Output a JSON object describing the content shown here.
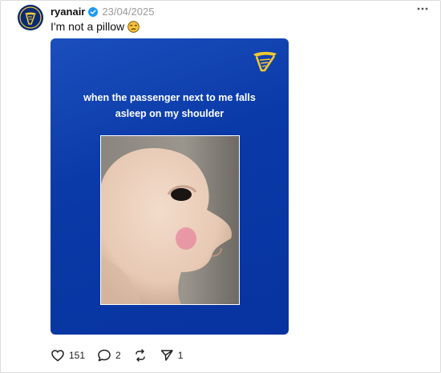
{
  "post": {
    "username": "ryanair",
    "date": "23/04/2025",
    "caption": "I'm not a pillow",
    "meme_text": "when the passenger next to me falls asleep on my shoulder"
  },
  "actions": {
    "likes": "151",
    "comments": "2",
    "reposts": "",
    "shares": "1"
  },
  "colors": {
    "brand_blue": "#0733a0",
    "brand_yellow": "#f1c933",
    "verified_blue": "#1d9bf0"
  },
  "icons": [
    "ryanair-harp-logo",
    "verified-badge-icon",
    "more-options-icon",
    "unamused-emoji",
    "heart-icon",
    "comment-icon",
    "repost-icon",
    "share-icon"
  ]
}
